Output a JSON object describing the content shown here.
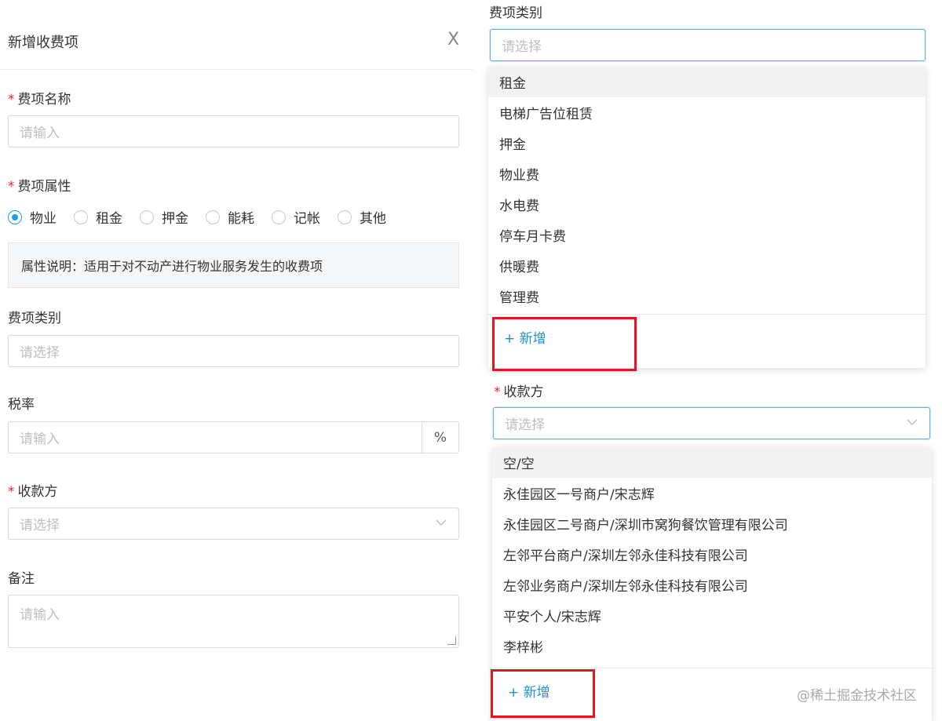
{
  "form": {
    "title": "新增收费项",
    "close": "X",
    "fields": {
      "name": {
        "label": "费项名称",
        "placeholder": "请输入"
      },
      "attr": {
        "label": "费项属性",
        "options": [
          "物业",
          "租金",
          "押金",
          "能耗",
          "记帐",
          "其他"
        ],
        "selected": "物业",
        "note": "属性说明：适用于对不动产进行物业服务发生的收费项"
      },
      "category": {
        "label": "费项类别",
        "placeholder": "请选择"
      },
      "tax": {
        "label": "税率",
        "placeholder": "请输入",
        "unit": "%"
      },
      "payee": {
        "label": "收款方",
        "placeholder": "请选择"
      },
      "remark": {
        "label": "备注",
        "placeholder": "请输入"
      }
    },
    "required_mark": "*"
  },
  "category_panel": {
    "label": "费项类别",
    "placeholder": "请选择",
    "options": [
      "租金",
      "电梯广告位租赁",
      "押金",
      "物业费",
      "水电费",
      "停车月卡费",
      "供暖费",
      "管理费"
    ],
    "highlighted": "租金",
    "add_label": "+ 新增"
  },
  "payee_panel": {
    "label": "收款方",
    "placeholder": "请选择",
    "options": [
      "空/空",
      "永佳园区一号商户/宋志辉",
      "永佳园区二号商户/深圳市窝狗餐饮管理有限公司",
      "左邻平台商户/深圳左邻永佳科技有限公司",
      "左邻业务商户/深圳左邻永佳科技有限公司",
      "平安个人/宋志辉",
      "李梓彬"
    ],
    "highlighted": "空/空",
    "add_label": "+ 新增"
  },
  "watermark": "@稀土掘金技术社区",
  "colors": {
    "accent": "#1f9bde",
    "required": "#f5222d",
    "highlight_box": "#e8141a"
  },
  "icons": {
    "radio_selected": "radio-selected-icon",
    "chevron": "chevron-down-icon",
    "close": "close-icon"
  }
}
